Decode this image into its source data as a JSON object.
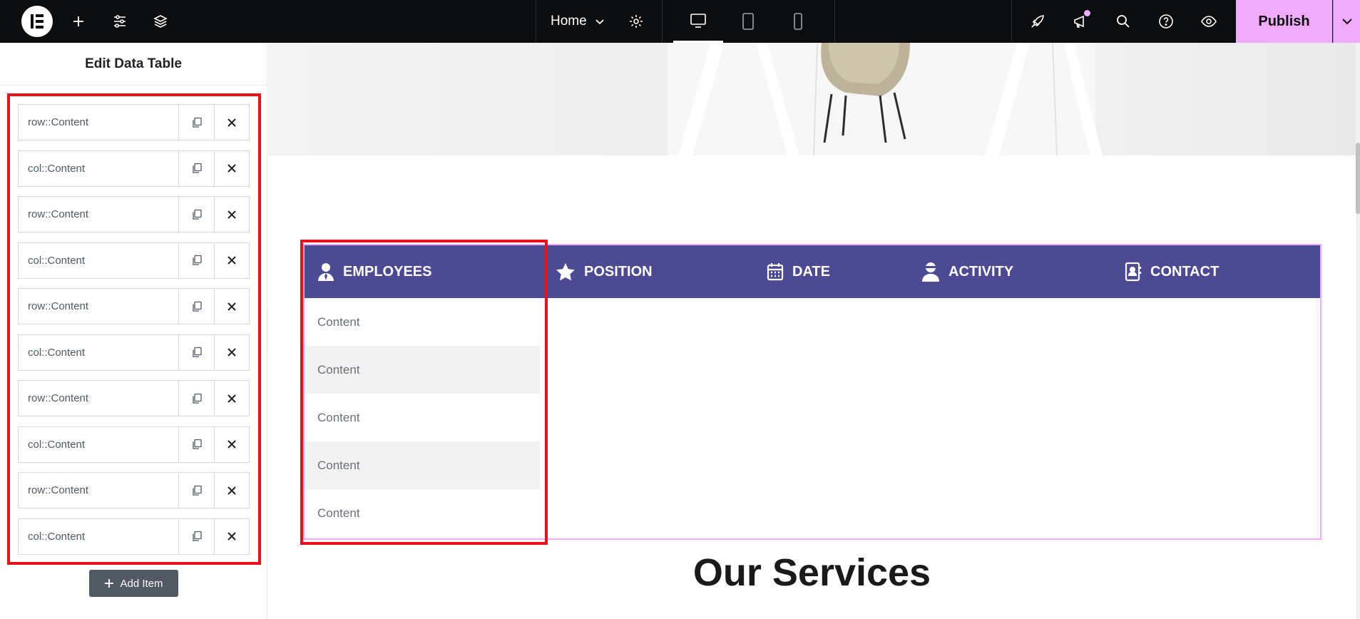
{
  "topbar": {
    "page_name": "Home",
    "publish_label": "Publish"
  },
  "panel": {
    "title": "Edit Data Table",
    "items": [
      {
        "label": "row::Content"
      },
      {
        "label": "col::Content"
      },
      {
        "label": "row::Content"
      },
      {
        "label": "col::Content"
      },
      {
        "label": "row::Content"
      },
      {
        "label": "col::Content"
      },
      {
        "label": "row::Content"
      },
      {
        "label": "col::Content"
      },
      {
        "label": "row::Content"
      },
      {
        "label": "col::Content"
      }
    ],
    "add_item_label": "Add Item"
  },
  "table": {
    "headers": [
      {
        "label": "EMPLOYEES",
        "icon": "user-tie-icon"
      },
      {
        "label": "POSITION",
        "icon": "star-icon"
      },
      {
        "label": "DATE",
        "icon": "calendar-icon"
      },
      {
        "label": "ACTIVITY",
        "icon": "user-activity-icon"
      },
      {
        "label": "CONTACT",
        "icon": "address-book-icon"
      }
    ],
    "rows": [
      "Content",
      "Content",
      "Content",
      "Content",
      "Content"
    ],
    "header_bg": "#4b4a92",
    "border_color": "#f0abfc"
  },
  "section": {
    "heading": "Our Services"
  },
  "colors": {
    "accent": "#f0abfc",
    "highlight": "#e8111a",
    "topbar": "#0c0d0e"
  }
}
